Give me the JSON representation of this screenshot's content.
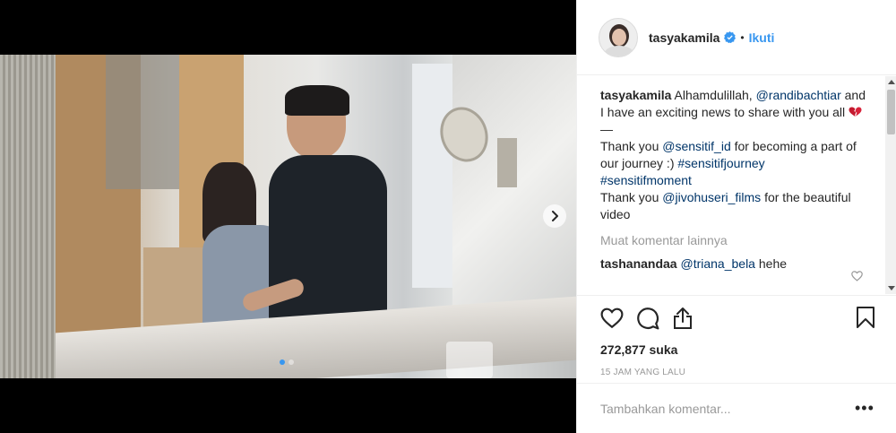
{
  "post": {
    "username": "tasyakamila",
    "follow_label": "Ikuti",
    "separator": "•",
    "caption": {
      "username": "tasyakamila",
      "text_1": " Alhamdulillah, ",
      "mention_1": "@randibachtiar",
      "text_2": " and I have an exciting news to share with you all ",
      "dash": "—",
      "text_3": "Thank you ",
      "mention_2": "@sensitif_id",
      "text_4": " for becoming a part of our journey :) ",
      "hashtag_1": "#sensitifjourney",
      "hashtag_2": "#sensitifmoment",
      "text_5": "Thank you ",
      "mention_3": "@jivohuseri_films",
      "text_6": " for the beautiful video"
    },
    "load_more": "Muat komentar lainnya",
    "comment": {
      "username": "tashanandaa",
      "mention": "@triana_bela",
      "text": " hehe"
    },
    "likes": "272,877 suka",
    "timestamp": "15 JAM YANG LALU",
    "add_comment_placeholder": "Tambahkan komentar...",
    "more_label": "•••"
  },
  "carousel": {
    "current": 1,
    "total": 2
  },
  "colors": {
    "link": "#003569",
    "follow": "#3897f0",
    "verified": "#3897f0",
    "heart": "#ed4956"
  },
  "icons": [
    "verified-badge-icon",
    "heart-icon",
    "comment-icon",
    "share-icon",
    "bookmark-icon",
    "chevron-right-icon",
    "more-icon"
  ]
}
